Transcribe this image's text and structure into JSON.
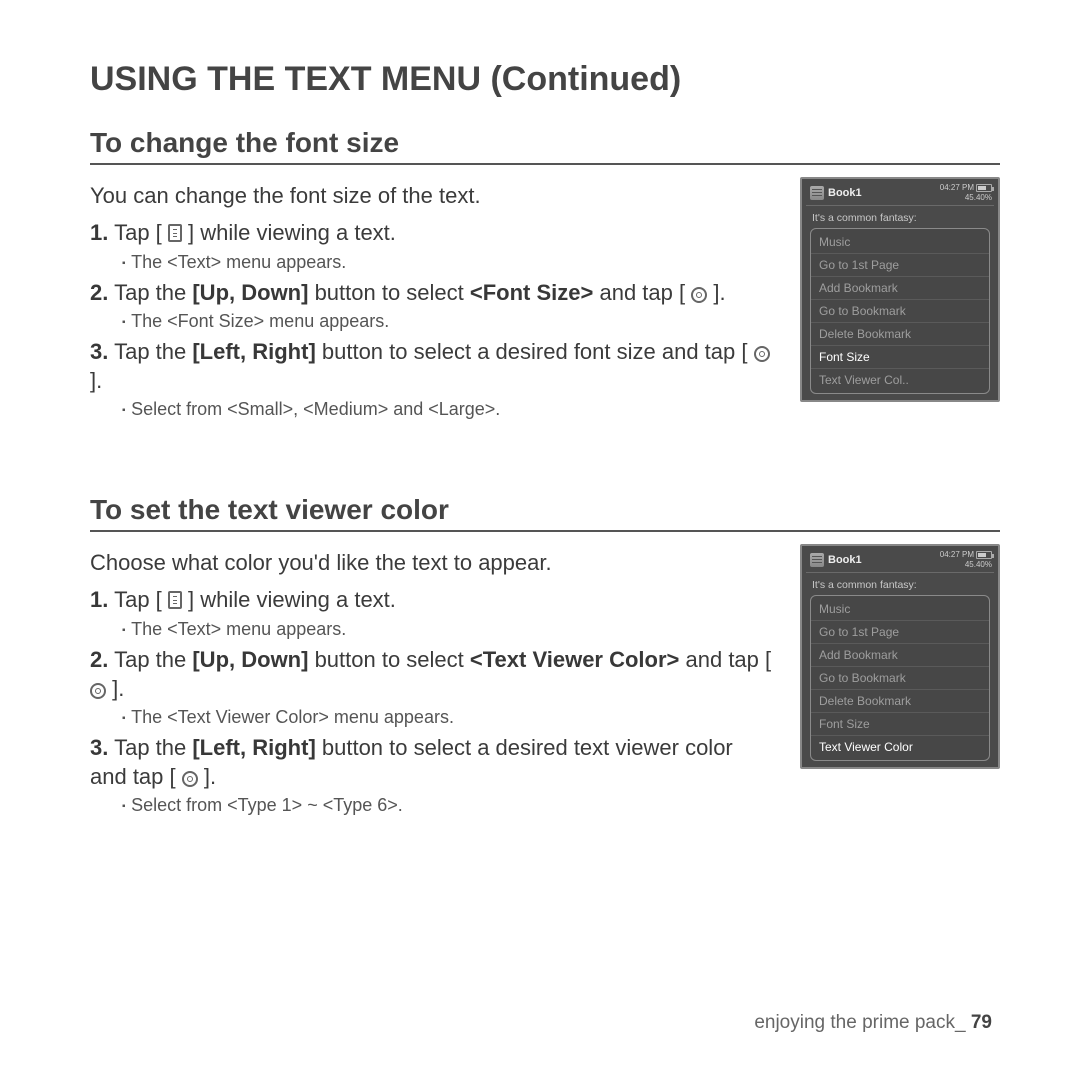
{
  "page_title": "USING THE TEXT MENU (Continued)",
  "section1": {
    "heading": "To change the font size",
    "intro": "You can change the font size of the text.",
    "step1_num": "1.",
    "step1_a": "Tap [",
    "step1_b": "] while viewing a text.",
    "step1_sub": "The <Text> menu appears.",
    "step2_num": "2.",
    "step2_a": "Tap the ",
    "step2_bold1": "[Up, Down]",
    "step2_b": " button to select ",
    "step2_bold2": "<Font Size>",
    "step2_c": " and tap [",
    "step2_d": "].",
    "step2_sub": "The <Font Size> menu appears.",
    "step3_num": "3.",
    "step3_a": "Tap the ",
    "step3_bold1": "[Left, Right]",
    "step3_b": " button to select a desired font size and tap [",
    "step3_c": "].",
    "step3_sub": "Select from <Small>, <Medium> and <Large>."
  },
  "section2": {
    "heading": "To set the text viewer color",
    "intro": "Choose what color you'd like the text to appear.",
    "step1_num": "1.",
    "step1_a": "Tap [",
    "step1_b": "] while viewing a text.",
    "step1_sub": "The <Text> menu appears.",
    "step2_num": "2.",
    "step2_a": "Tap the ",
    "step2_bold1": "[Up, Down]",
    "step2_b": " button to select ",
    "step2_bold2": "<Text Viewer Color>",
    "step2_c": " and tap [",
    "step2_d": "].",
    "step2_sub": "The <Text Viewer Color> menu appears.",
    "step3_num": "3.",
    "step3_a": "Tap the ",
    "step3_bold1": "[Left, Right]",
    "step3_b": " button to select a desired text viewer color and tap [",
    "step3_c": "].",
    "step3_sub": "Select from <Type 1> ~ <Type 6>."
  },
  "device1": {
    "time": "04:27 PM",
    "battery_pct": "45.40%",
    "book": "Book1",
    "fantasy": "It's a common fantasy:",
    "menu": [
      "Music",
      "Go to 1st Page",
      "Add Bookmark",
      "Go to Bookmark",
      "Delete Bookmark",
      "Font Size",
      "Text Viewer Col.."
    ],
    "selected_index": 5
  },
  "device2": {
    "time": "04:27 PM",
    "battery_pct": "45.40%",
    "book": "Book1",
    "fantasy": "It's a common fantasy:",
    "menu": [
      "Music",
      "Go to 1st Page",
      "Add Bookmark",
      "Go to Bookmark",
      "Delete Bookmark",
      "Font Size",
      "Text Viewer Color"
    ],
    "selected_index": 6
  },
  "footer": {
    "chapter": "enjoying the prime pack_",
    "page": "79"
  }
}
